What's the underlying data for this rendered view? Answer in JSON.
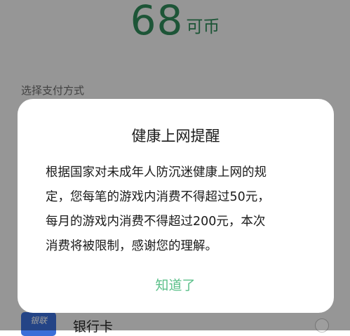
{
  "amount": {
    "value": "68",
    "unit": "可币"
  },
  "payment": {
    "section_label": "选择支付方式",
    "options": [
      {
        "icon": "bank-card-icon",
        "icon_text": "银联",
        "label": "银行卡"
      }
    ]
  },
  "dialog": {
    "title": "健康上网提醒",
    "body_lines": [
      "根据国家对未成年人防沉迷健康上网的规",
      "定，您每笔的游戏内消费不得超过50元，",
      "每月的游戏内消费不得超过200元，本次",
      "消费将被限制，感谢您的理解。"
    ],
    "confirm_label": "知道了"
  },
  "colors": {
    "accent_green": "#2f8a5a",
    "button_green": "#5cc08a",
    "overlay": "rgba(0,0,0,0.38)"
  }
}
